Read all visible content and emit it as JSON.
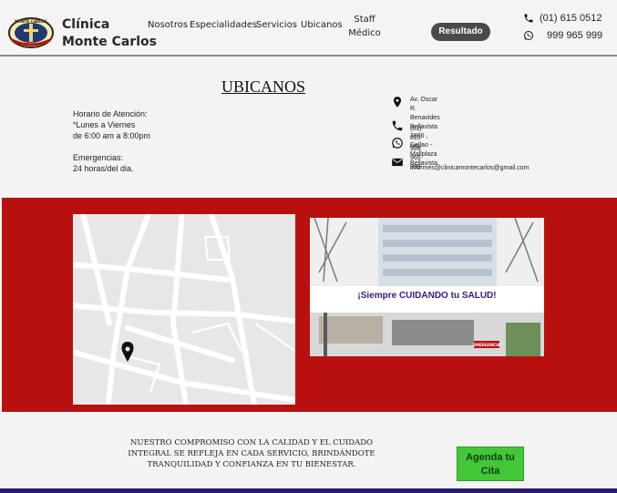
{
  "header": {
    "brand_line1": "Clínica",
    "brand_line2": "Monte Carlos",
    "logo_text": "MONTE CARLOS",
    "nav": [
      "Nosotros",
      "Especialidades",
      "Servicios",
      "Ubicanos"
    ],
    "staff_line1": "Staff",
    "staff_line2": "Médico",
    "result_button": "Resultado",
    "phone": "(01) 615 0512",
    "whatsapp": "999 965 999"
  },
  "ubicanos": {
    "title": "UBICANOS",
    "hours_label": "Horario de Atención:",
    "hours_days": "*Lunes a Viernes",
    "hours_time": "de 6:00 am a 8:00pm",
    "emergency_label": "Emergencias:",
    "emergency_value": "24 horas/del dia."
  },
  "contact": {
    "address_line1": "Av. Oscar R. Benavides Bellavista 3866 ,",
    "address_line2": "Callao - Mallplaza Bellavista",
    "phone": "(01) 619 051",
    "whatsapp": "999 965 999",
    "email": "informes@clinicamontecarlos@gmail.com"
  },
  "band": {
    "slogan": "¡Siempre CUIDANDO tu SALUD!",
    "sign_text": "EMERGENCIA"
  },
  "footer": {
    "commitment_line1": "NUESTRO COMPROMISO CON LA CALIDAD Y EL CUIDADO",
    "commitment_line2": "INTEGRAL SE REFLEJA EN CADA SERVICIO, BRINDÁNDOTE",
    "commitment_line3": "TRANQUILIDAD Y CONFIANZA EN TU BIENESTAR.",
    "cta_line1": "Agenda tu",
    "cta_line2": "Cita"
  },
  "colors": {
    "band": "#b8100f",
    "cta": "#44c639",
    "result_button": "#4a4a4a",
    "bottom_bar": "#2a1a6e"
  },
  "icons": [
    "logo-emblem",
    "phone-icon",
    "whatsapp-icon",
    "map-pin-icon",
    "mail-icon"
  ]
}
